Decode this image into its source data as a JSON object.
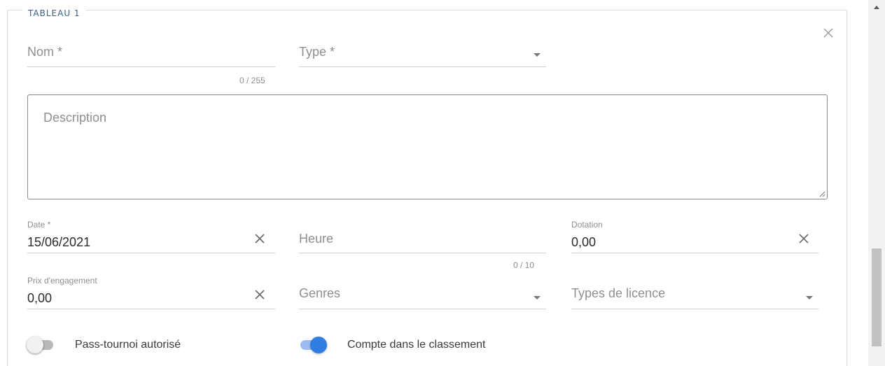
{
  "section": {
    "legend": "TABLEAU 1"
  },
  "fields": {
    "nom": {
      "placeholder": "Nom *",
      "counter": "0 / 255"
    },
    "type": {
      "placeholder": "Type *"
    },
    "description": {
      "placeholder": "Description"
    },
    "date": {
      "label": "Date *",
      "value": "15/06/2021"
    },
    "heure": {
      "placeholder": "Heure",
      "counter": "0 / 10"
    },
    "dotation": {
      "label": "Dotation",
      "value": "0,00"
    },
    "prix_engagement": {
      "label": "Prix d'engagement",
      "value": "0,00"
    },
    "genres": {
      "placeholder": "Genres"
    },
    "types_licence": {
      "placeholder": "Types de licence"
    }
  },
  "toggles": {
    "pass_tournoi": {
      "label": "Pass-tournoi autorisé",
      "checked": false
    },
    "compte_classement": {
      "label": "Compte dans le classement",
      "checked": true
    }
  },
  "colors": {
    "accent": "#2f7de1",
    "accent_track": "#9cbdf2",
    "legend": "#3a5f86"
  },
  "icons": [
    "close-icon",
    "clear-icon",
    "dropdown-caret-icon",
    "resize-grip-icon",
    "scroll-up-arrow-icon"
  ]
}
